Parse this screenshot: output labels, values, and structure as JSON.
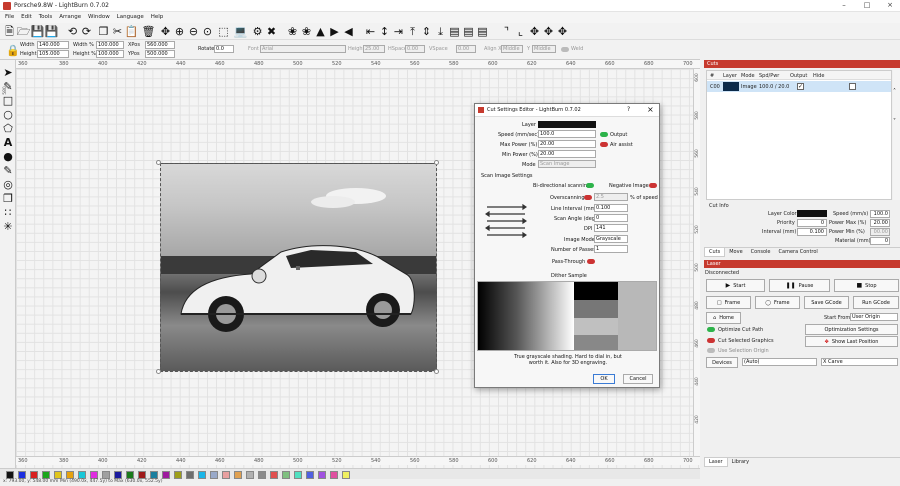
{
  "window": {
    "title": "Porsche9.8W - LightBurn 0.7.02",
    "minimize_icon": "minimize-icon",
    "maximize_icon": "maximize-icon",
    "close_icon": "close-icon"
  },
  "menu": [
    "File",
    "Edit",
    "Tools",
    "Arrange",
    "Window",
    "Language",
    "Help"
  ],
  "shape_props": {
    "width_label": "Width",
    "width_value": "140.000",
    "height_label": "Height",
    "height_value": "105.000",
    "width_pct_label": "Width %",
    "width_pct_value": "100.000",
    "height_pct_label": "Height %",
    "height_pct_value": "100.000",
    "xpos_label": "XPos",
    "xpos_value": "560.000",
    "ypos_label": "YPos",
    "ypos_value": "500.000",
    "rotate_label": "Rotate",
    "rotate_value": "0.0",
    "font_label": "Font",
    "font_value": "Arial",
    "height2_label": "Height",
    "height2_value": "25.00",
    "hspace_label": "HSpace",
    "hspace_value": "0.00",
    "vspace_label": "VSpace",
    "vspace_value": "0.00",
    "alignx_label": "Align X",
    "alignx_value": "Middle",
    "aligny_label": "Y",
    "aligny_value": "Middle",
    "weld_label": "Weld"
  },
  "ruler": {
    "top": [
      "380",
      "400",
      "420",
      "440",
      "460",
      "480",
      "500",
      "520",
      "540",
      "560",
      "580",
      "600",
      "620",
      "640",
      "660",
      "680",
      "700"
    ],
    "bottom": [
      "360",
      "380",
      "400",
      "420",
      "440",
      "460",
      "480",
      "500",
      "520",
      "540",
      "560",
      "580",
      "600",
      "620",
      "640",
      "660",
      "680",
      "700"
    ],
    "leftcorner_top": "360",
    "leftcorner_bottom": "360",
    "vertical": [
      "600",
      "580",
      "560",
      "540",
      "520",
      "500",
      "480",
      "460",
      "440",
      "420",
      "400"
    ]
  },
  "palette": [
    "#111111",
    "#1b2ee0",
    "#d81f1f",
    "#1aa61a",
    "#e0c51c",
    "#e6a10f",
    "#18c7d8",
    "#e02ce0",
    "#a0a0a0",
    "#1a1a9e",
    "#1a7a1a",
    "#9e1a1a",
    "#1a7e9e",
    "#9e1a9e",
    "#9e9e1a",
    "#6e6e6e",
    "#1ab6e8",
    "#99a9c9",
    "#e8a0a0",
    "#e0a050",
    "#b0b0b0",
    "#8a8a8a",
    "#e05050",
    "#80c080",
    "#50e0c0",
    "#5060e0",
    "#a050e0",
    "#e050a0",
    "#f0f060",
    "#c06030",
    "#306090",
    "#6090c0",
    "#c0c060",
    "#e080c0"
  ],
  "status": {
    "coords": "x: 793.00, y: 548.00 mm",
    "bounds": "Min (490.0x, 447.5y) to Max (630.0x, 552.5y)"
  },
  "cuts": {
    "title": "Cuts",
    "columns": [
      "#",
      "Layer",
      "Mode",
      "Spd/Pwr",
      "Output",
      "Hide"
    ],
    "rows": [
      {
        "num": "C00",
        "mode": "Image",
        "spd": "100.0 / 20.0",
        "color": "#0b2a4a"
      }
    ]
  },
  "cut_info": {
    "title": "Cut Info",
    "layer_color_label": "Layer Color",
    "priority_label": "Priority",
    "priority_value": "0",
    "interval_label": "Interval (mm)",
    "interval_value": "0.100",
    "speed_label": "Speed (mm/s)",
    "speed_value": "100.0",
    "power_max_label": "Power Max (%)",
    "power_max_value": "20.00",
    "power_min_label": "Power Min (%)",
    "power_min_value": "00.00",
    "material_label": "Material (mm)",
    "material_value": "0"
  },
  "cuts_tabs": [
    "Cuts",
    "Move",
    "Console",
    "Camera Control"
  ],
  "laser": {
    "title": "Laser",
    "status": "Disconnected",
    "start": "Start",
    "pause": "Pause",
    "stop": "Stop",
    "frame1": "Frame",
    "frame2": "Frame",
    "save_gcode": "Save GCode",
    "run_gcode": "Run GCode",
    "home": "Home",
    "start_from_label": "Start From:",
    "start_from_value": "User Origin",
    "optimize_cut": "Optimize Cut Path",
    "optimization_settings": "Optimization Settings",
    "cut_selected": "Cut Selected Graphics",
    "show_last": "Show Last Position",
    "use_selection_origin": "Use Selection Origin",
    "devices": "Devices",
    "device_value": "(Auto)",
    "carve_value": "X Carve"
  },
  "laser_tabs": [
    "Laser",
    "Library"
  ],
  "dialog": {
    "title": "Cut Settings Editor - LightBurn 0.7.02",
    "help": "?",
    "close": "×",
    "layer_label": "Layer",
    "speed_label": "Speed (mm/sec)",
    "speed_value": "100.0",
    "output_label": "Output",
    "max_power_label": "Max Power (%)",
    "max_power_value": "20.00",
    "air_assist_label": "Air assist",
    "min_power_label": "Min Power (%)",
    "min_power_value": "20.00",
    "mode_label": "Mode",
    "mode_value": "Scan Image",
    "section": "Scan Image Settings",
    "bidir_label": "Bi-directional scanning",
    "negative_label": "Negative Image",
    "overscan_label": "Overscanning",
    "overscan_value": "2.5",
    "overscan_unit": "% of speed",
    "line_interval_label": "Line Interval (mm)",
    "line_interval_value": "0.100",
    "scan_angle_label": "Scan Angle (deg)",
    "scan_angle_value": "0",
    "dpi_label": "DPI",
    "dpi_value": "141",
    "image_mode_label": "Image Mode",
    "image_mode_value": "Grayscale",
    "passes_label": "Number of Passes",
    "passes_value": "1",
    "passthrough_label": "Pass-Through",
    "dither_label": "Dither Sample",
    "desc": "True grayscale shading. Hard to dial in, but worth it. Also for 3D engraving.",
    "ok": "OK",
    "cancel": "Cancel"
  }
}
